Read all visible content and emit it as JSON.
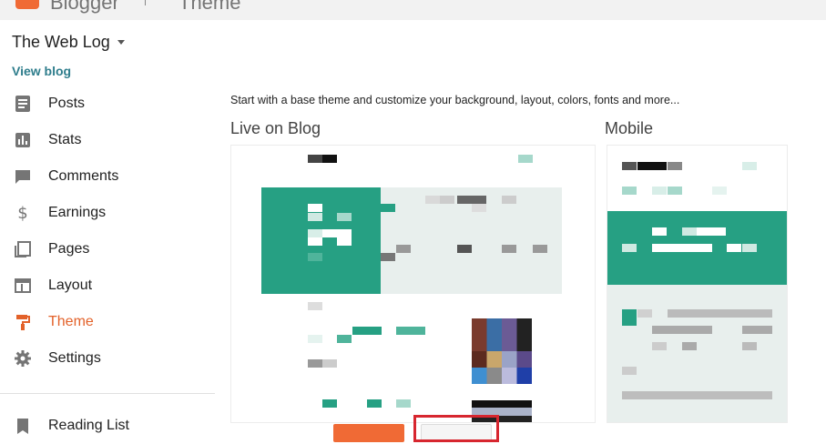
{
  "topbar": {
    "brand": "Blogger",
    "section": "Theme"
  },
  "blog": {
    "name": "The Web Log",
    "view_blog": "View blog"
  },
  "nav": {
    "items": [
      {
        "label": "Posts",
        "icon": "posts-icon"
      },
      {
        "label": "Stats",
        "icon": "stats-icon"
      },
      {
        "label": "Comments",
        "icon": "comments-icon"
      },
      {
        "label": "Earnings",
        "icon": "dollar-icon"
      },
      {
        "label": "Pages",
        "icon": "pages-icon"
      },
      {
        "label": "Layout",
        "icon": "layout-icon"
      },
      {
        "label": "Theme",
        "icon": "paint-roller-icon",
        "active": true
      },
      {
        "label": "Settings",
        "icon": "gear-icon"
      }
    ],
    "reading_list": "Reading List"
  },
  "main": {
    "intro": "Start with a base theme and customize your background, layout, colors, fonts and more...",
    "live_title": "Live on Blog",
    "mobile_title": "Mobile"
  },
  "colors": {
    "accent": "#e3622a",
    "brand_orange": "#f06a35",
    "theme_green": "#26a083",
    "theme_light": "#e8efed",
    "highlight_red": "#d7262f",
    "link_teal": "#2e7d8c"
  }
}
